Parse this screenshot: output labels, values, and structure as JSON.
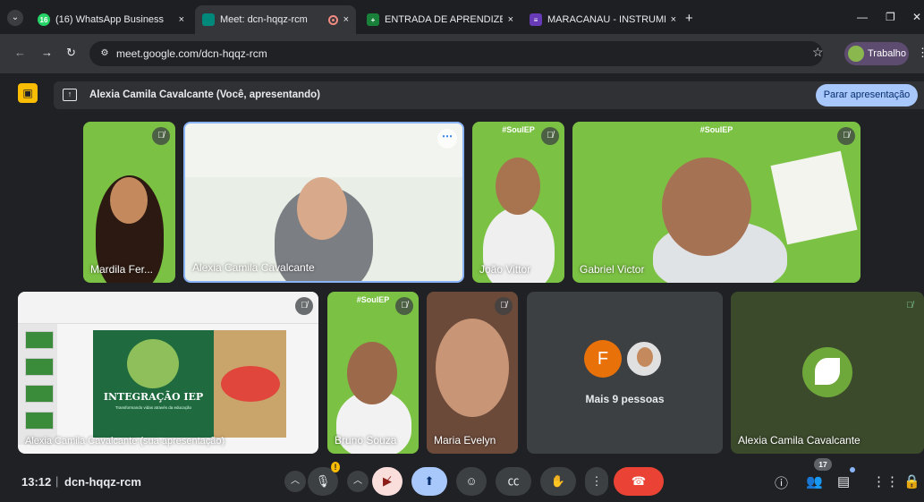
{
  "browser": {
    "tabs": [
      {
        "label": "(16) WhatsApp Business",
        "favicon_text": "16",
        "favicon_color": "#25d366",
        "active": false
      },
      {
        "label": "Meet: dcn-hqqz-rcm",
        "favicon_text": "",
        "favicon_color": "#00897b",
        "active": true
      },
      {
        "label": "ENTRADA DE APRENDIZES - M",
        "favicon_text": "+",
        "favicon_color": "#188038",
        "active": false
      },
      {
        "label": "MARACANAU - INSTRUMENTAI",
        "favicon_text": "≡",
        "favicon_color": "#673ab7",
        "active": false
      }
    ],
    "close_glyph": "×",
    "new_tab_glyph": "+",
    "url": "meet.google.com/dcn-hqqz-rcm",
    "profile_label": "Trabalho"
  },
  "banner": {
    "presenter_text": "Alexia Camila Cavalcante (Você, apresentando)",
    "stop_label": "Parar apresentação"
  },
  "tiles": [
    {
      "name": "Mardila Fer...",
      "muted": true
    },
    {
      "name": "Alexia Camila Cavalcante",
      "muted": false,
      "pinned_menu": true
    },
    {
      "name": "João Vittor",
      "muted": true,
      "background_label": "#SoulEP"
    },
    {
      "name": "Gabriel Victor",
      "muted": true,
      "background_label": "#SoulEP"
    },
    {
      "name": "Alexia Camila Cavalcante (sua apresentação)",
      "muted": true
    },
    {
      "name": "Bruno Souza",
      "muted": true,
      "background_label": "#SoulEP"
    },
    {
      "name": "Maria Evelyn",
      "muted": true
    },
    {
      "name": "Mais 9 pessoas",
      "avatar_letter": "F",
      "avatar_color": "#e8710a"
    },
    {
      "name": "Alexia Camila Cavalcante",
      "muted": true
    }
  ],
  "slide": {
    "title": "INTEGRAÇÃO IEP",
    "subtitle": "Transformando vidas através da educação"
  },
  "controls": {
    "time": "13:12",
    "separator": "|",
    "meeting_code": "dcn-hqqz-rcm",
    "participants_count": "17"
  },
  "colors": {
    "accent": "#a8c7fa",
    "end_call": "#ea4335",
    "camera_off": "#f9dedc",
    "present_active": "#a8c7fa",
    "background_green": "#7bc143"
  }
}
